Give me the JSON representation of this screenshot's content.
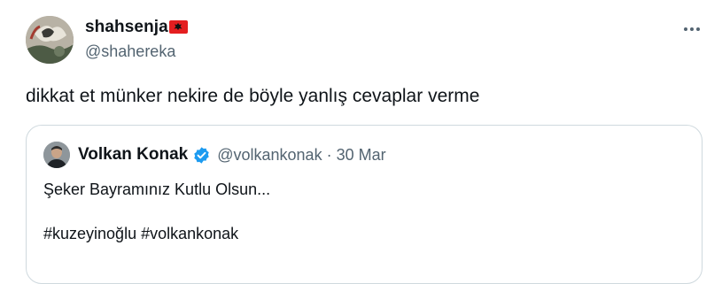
{
  "tweet": {
    "display_name": "shahsenja",
    "flag_icon": "albania-flag-icon",
    "handle": "@shahereka",
    "text": "dikkat et münker nekire de böyle yanlış cevaplar verme",
    "more_icon": "more-horizontal-icon"
  },
  "quote": {
    "display_name": "Volkan Konak",
    "verified_icon": "verified-badge-icon",
    "handle": "@volkankonak",
    "separator": "·",
    "date": "30 Mar",
    "text": "Şeker Bayramınız Kutlu Olsun...",
    "hashtags": "#kuzeyinoğlu #volkankonak"
  },
  "colors": {
    "text_primary": "#0f1419",
    "text_secondary": "#536471",
    "border": "#cfd9de",
    "verified_blue": "#1d9bf0",
    "flag_red": "#e41e20"
  }
}
